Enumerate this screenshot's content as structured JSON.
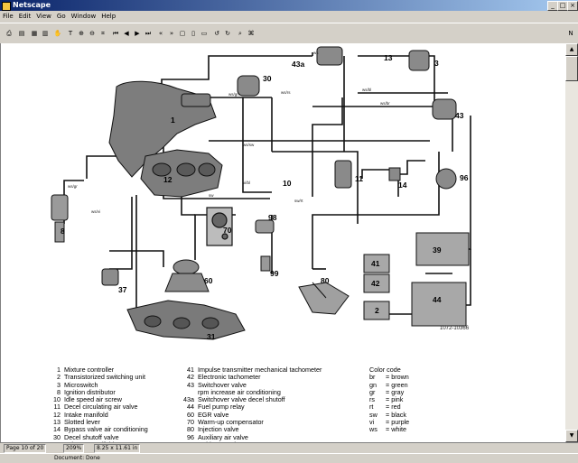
{
  "window": {
    "title": "Netscape",
    "controls": [
      "_",
      "□",
      "×"
    ]
  },
  "menu": [
    "File",
    "Edit",
    "View",
    "Go",
    "Window",
    "Help"
  ],
  "diagram": {
    "labels": [
      "1",
      "2",
      "3",
      "8",
      "10",
      "11",
      "12",
      "13",
      "14",
      "30",
      "31",
      "37",
      "39",
      "41",
      "42",
      "43",
      "43a",
      "44",
      "60",
      "70",
      "80",
      "96",
      "98",
      "99"
    ],
    "wire_labels": [
      "ws/sw",
      "ws/rs",
      "ws/bl",
      "ws/br",
      "sw",
      "ws/gn",
      "ws/gr",
      "ws/vi",
      "ws",
      "vi/bl",
      "sw/rt"
    ],
    "figure_id": "1072-10366"
  },
  "legend": {
    "col1": [
      {
        "n": "1",
        "t": "Mixture controller"
      },
      {
        "n": "2",
        "t": "Transistorized switching unit"
      },
      {
        "n": "3",
        "t": "Microswitch"
      },
      {
        "n": "8",
        "t": "Ignition distributor"
      },
      {
        "n": "10",
        "t": "Idle speed air screw"
      },
      {
        "n": "11",
        "t": "Decel circulating air valve"
      },
      {
        "n": "12",
        "t": "Intake manifold"
      },
      {
        "n": "13",
        "t": "Slotted lever"
      },
      {
        "n": "14",
        "t": "Bypass valve air conditioning"
      },
      {
        "n": "30",
        "t": "Decel shutoff valve"
      },
      {
        "n": "31",
        "t": "Exhaust manifold"
      }
    ],
    "col2": [
      {
        "n": "41",
        "t": "Impulse transmitter mechanical tachometer"
      },
      {
        "n": "42",
        "t": "Electronic tachometer"
      },
      {
        "n": "43",
        "t": "Switchover valve"
      },
      {
        "n": "",
        "t": "rpm increase air conditioning"
      },
      {
        "n": "43a",
        "t": "Switchover valve decel shutoff"
      },
      {
        "n": "44",
        "t": "Fuel pump relay"
      },
      {
        "n": "60",
        "t": "EGR valve"
      },
      {
        "n": "70",
        "t": "Warm-up compensator"
      },
      {
        "n": "80",
        "t": "Injection valve"
      },
      {
        "n": "96",
        "t": "Auxiliary air valve"
      },
      {
        "n": "98",
        "t": "Cold start valve"
      }
    ],
    "color_code_title": "Color code",
    "colors": [
      {
        "c": "br",
        "t": "= brown"
      },
      {
        "c": "gn",
        "t": "= green"
      },
      {
        "c": "gr",
        "t": "= gray"
      },
      {
        "c": "rs",
        "t": "= pink"
      },
      {
        "c": "rt",
        "t": "= red"
      },
      {
        "c": "sw",
        "t": "= black"
      },
      {
        "c": "vi",
        "t": "= purple"
      },
      {
        "c": "ws",
        "t": "= white"
      }
    ]
  },
  "nav": {
    "page": "Page 10 of 20",
    "zoom": "209%",
    "size": "8.25 x 11.61 in"
  },
  "status": {
    "text": "Document: Done"
  }
}
